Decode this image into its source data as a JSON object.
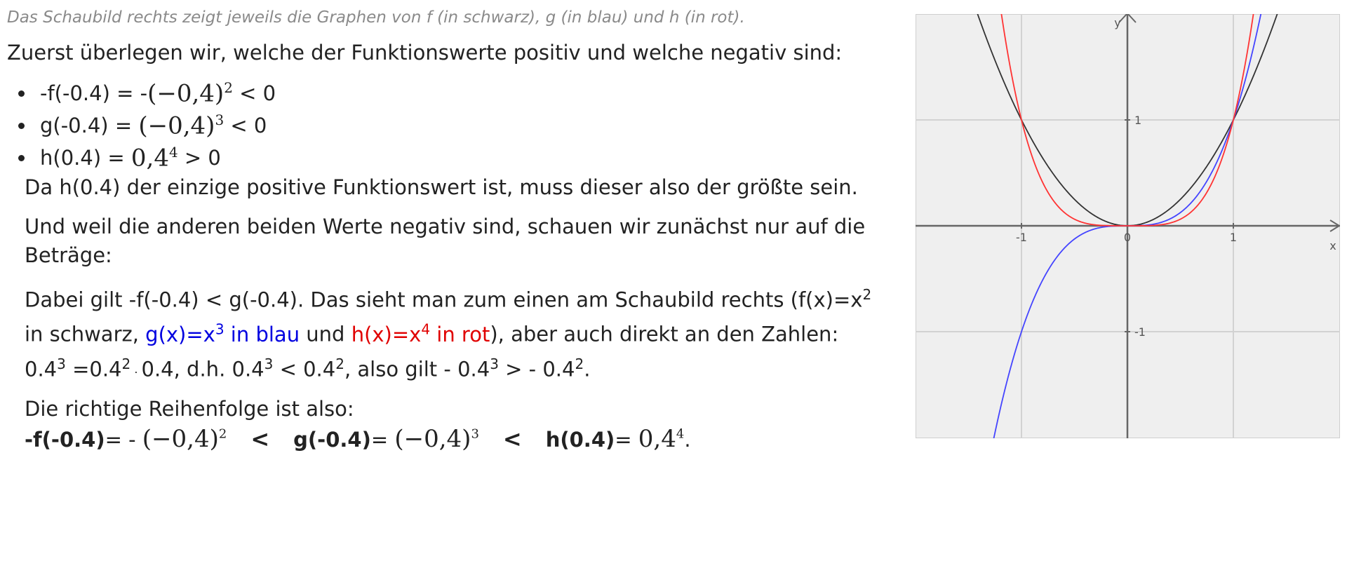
{
  "caption": "Das Schaubild rechts zeigt jeweils die Graphen von f (in schwarz), g (in blau) und h (in rot).",
  "intro": "Zuerst überlegen wir, welche der Funktionswerte positiv und welche negativ sind:",
  "bullets": [
    {
      "lhs": "-f(-0.4) = - ",
      "math": "(−0,4)",
      "exp": "2",
      "rhs": " < 0"
    },
    {
      "lhs": "g(-0.4) = ",
      "math": "(−0,4)",
      "exp": "3",
      "rhs": " < 0"
    },
    {
      "lhs": "h(0.4) = ",
      "math": "0,4",
      "exp": "4",
      "rhs": " > 0"
    }
  ],
  "para1": "Da h(0.4) der einzige positive Funktionswert ist, muss dieser also der größte sein.",
  "para2_line1": "Und weil die anderen beiden Werte negativ sind, schauen wir zunächst nur auf die",
  "para2_line2": "Beträge:",
  "para3": {
    "part1": "Dabei gilt -f(-0.4) < g(-0.4). Das sieht man zum einen am Schaubild rechts (f(x)=x",
    "part1_exp": "2",
    "line2_a": "in schwarz, ",
    "line2_blue": "g(x)=x",
    "line2_blue_exp": "3",
    "line2_blue_tail": " in blau",
    "line2_und": " und ",
    "line2_red": "h(x)=x",
    "line2_red_exp": "4",
    "line2_red_tail": " in rot",
    "line2_end": "), aber auch direkt an den Zahlen:",
    "line3_a": "0.4",
    "line3_e1": "3",
    "line3_b": " =0.4",
    "line3_e2": "2",
    "line3_dot": " · ",
    "line3_c": "0.4, d.h. 0.4",
    "line3_e3": "3",
    "line3_d": " < 0.4",
    "line3_e4": "2",
    "line3_f": ", also gilt - 0.4",
    "line3_e5": "3",
    "line3_g": " > - 0.4",
    "line3_e6": "2",
    "line3_h": "."
  },
  "conclusion_intro": "Die richtige Reihenfolge ist also:",
  "final": {
    "t1": "-f(-0.4)",
    "t1_eq": "= - ",
    "t1_math": "(−0,4)",
    "t1_exp": "2",
    "sep1": "<",
    "t2": "g(-0.4)",
    "t2_eq": "= ",
    "t2_math": "(−0,4)",
    "t2_exp": "3",
    "sep2": "<",
    "t3": "h(0.4)",
    "t3_eq": "= ",
    "t3_math": "0,4",
    "t3_exp": "4",
    "t3_end": "."
  },
  "chart_data": {
    "type": "line",
    "xlabel": "x",
    "ylabel": "y",
    "xlim": [
      -2,
      2
    ],
    "ylim": [
      -2,
      2
    ],
    "x_ticks": [
      "-1",
      "0",
      "1"
    ],
    "y_ticks": [
      "1",
      "-1"
    ],
    "grid": true,
    "series": [
      {
        "color": "#333333",
        "function": "x^2"
      },
      {
        "color": "#4444ff",
        "function": "x^3"
      },
      {
        "color": "#ff3333",
        "function": "x^4"
      }
    ]
  }
}
